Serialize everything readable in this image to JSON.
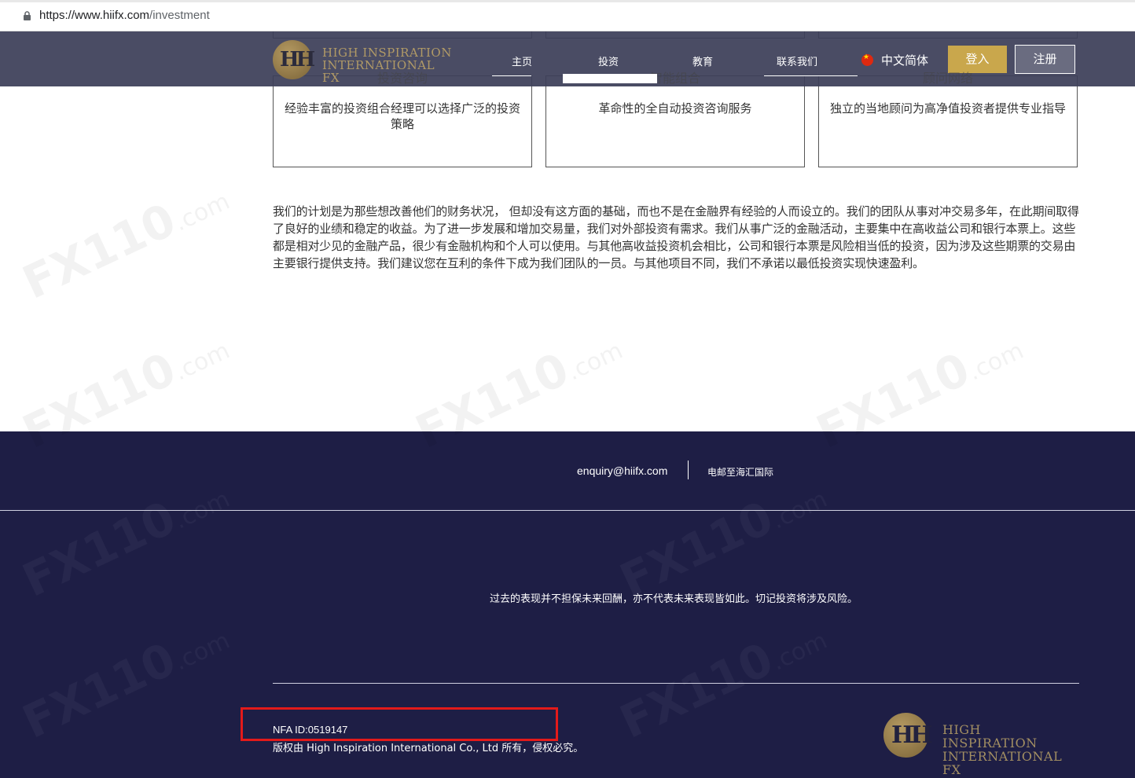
{
  "browser": {
    "url_host": "https://www.hiifx.com",
    "url_path": "/investment"
  },
  "header": {
    "logo_mark": "HH",
    "logo_line1": "HIGH INSPIRATION",
    "logo_line2": "INTERNATIONAL FX",
    "nav": [
      "主页",
      "投资",
      "教育",
      "联系我们"
    ],
    "language": "中文简体",
    "login": "登入",
    "register": "注册"
  },
  "cards": [
    {
      "title": "投资咨询",
      "text": "经验丰富的投资组合经理可以选择广泛的投资策略"
    },
    {
      "title": "智能组合",
      "text": "革命性的全自动投资咨询服务"
    },
    {
      "title": "顾问网络",
      "text": "独立的当地顾问为高净值投资者提供专业指导"
    }
  ],
  "intro_paragraph": "我们的计划是为那些想改善他们的财务状况， 但却没有这方面的基础，而也不是在金融界有经验的人而设立的。我们的团队从事对冲交易多年，在此期间取得了良好的业绩和稳定的收益。为了进一步发展和增加交易量，我们对外部投资有需求。我们从事广泛的金融活动，主要集中在高收益公司和银行本票上。这些都是相对少见的金融产品，很少有金融机构和个人可以使用。与其他高收益投资机会相比，公司和银行本票是风险相当低的投资，因为涉及这些期票的交易由主要银行提供支持。我们建议您在互利的条件下成为我们团队的一员。与其他项目不同，我们不承诺以最低投资实现快速盈利。",
  "footer": {
    "email": "enquiry@hiifx.com",
    "mail_link": "电邮至海汇国际",
    "disclaimer": "过去的表现并不担保未来回酬，亦不代表未来表现皆如此。切记投资将涉及风险。",
    "nfa_id": "NFA ID:0519147",
    "copyright": "版权由 High Inspiration International Co., Ltd 所有，侵权必究。",
    "logo_line1": "HIGH INSPIRATION",
    "logo_line2": "INTERNATIONAL FX"
  },
  "colors": {
    "header_bg": "#3c3e58",
    "footer_bg": "#1e1e45",
    "gold": "#c9a74c",
    "highlight_box": "#e31a1a"
  }
}
